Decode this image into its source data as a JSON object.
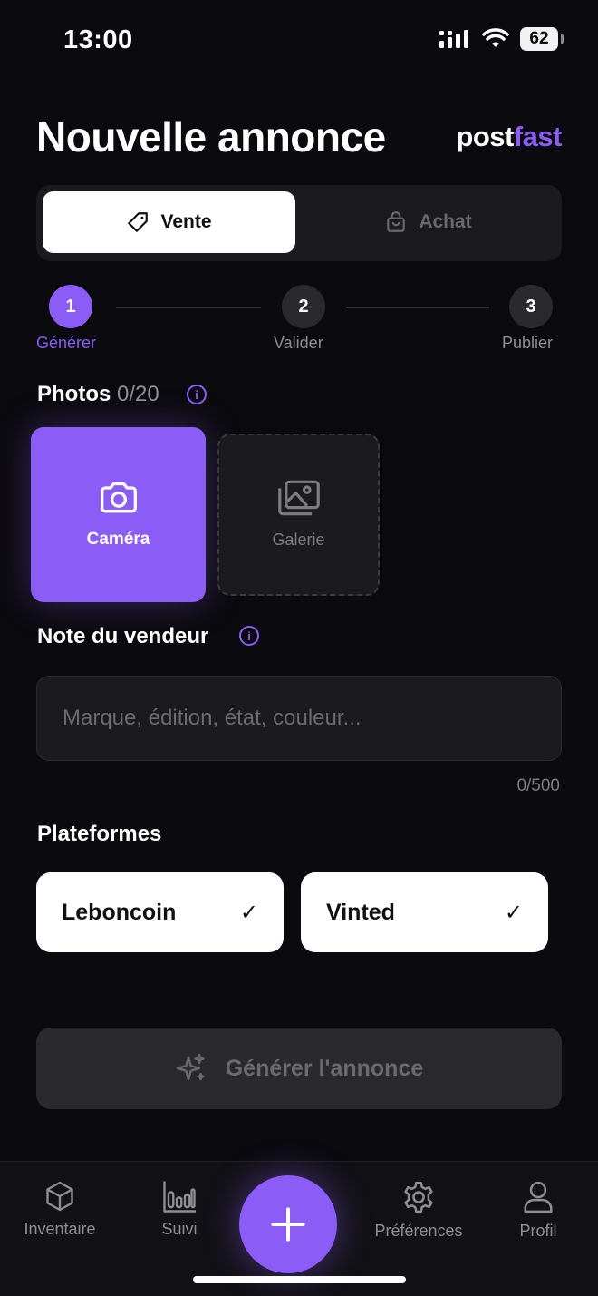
{
  "status": {
    "time": "13:00",
    "battery": "62"
  },
  "header": {
    "title": "Nouvelle annonce",
    "brand_part1": "post",
    "brand_part2": "fast"
  },
  "segment": {
    "active": "Vente",
    "inactive": "Achat"
  },
  "stepper": [
    {
      "number": "1",
      "label": "Générer"
    },
    {
      "number": "2",
      "label": "Valider"
    },
    {
      "number": "3",
      "label": "Publier"
    }
  ],
  "photos": {
    "title": "Photos",
    "count": "0/20",
    "camera_label": "Caméra",
    "gallery_label": "Galerie"
  },
  "note": {
    "title": "Note du vendeur",
    "placeholder": "Marque, édition, état, couleur...",
    "counter": "0/500"
  },
  "platforms": {
    "title": "Plateformes",
    "items": [
      {
        "label": "Leboncoin",
        "check": "✓"
      },
      {
        "label": "Vinted",
        "check": "✓"
      }
    ]
  },
  "generate": {
    "label": "Générer l'annonce"
  },
  "nav": {
    "items": [
      {
        "label": "Inventaire",
        "icon": "cube-icon"
      },
      {
        "label": "Suivi",
        "icon": "bar-chart-icon"
      },
      {
        "label": "Préférences",
        "icon": "gear-icon"
      },
      {
        "label": "Profil",
        "icon": "user-icon"
      }
    ],
    "fab_icon": "plus-icon"
  },
  "colors": {
    "accent": "#8b5cf6",
    "background": "#0b0a0e",
    "surface": "#1b1a1f"
  }
}
